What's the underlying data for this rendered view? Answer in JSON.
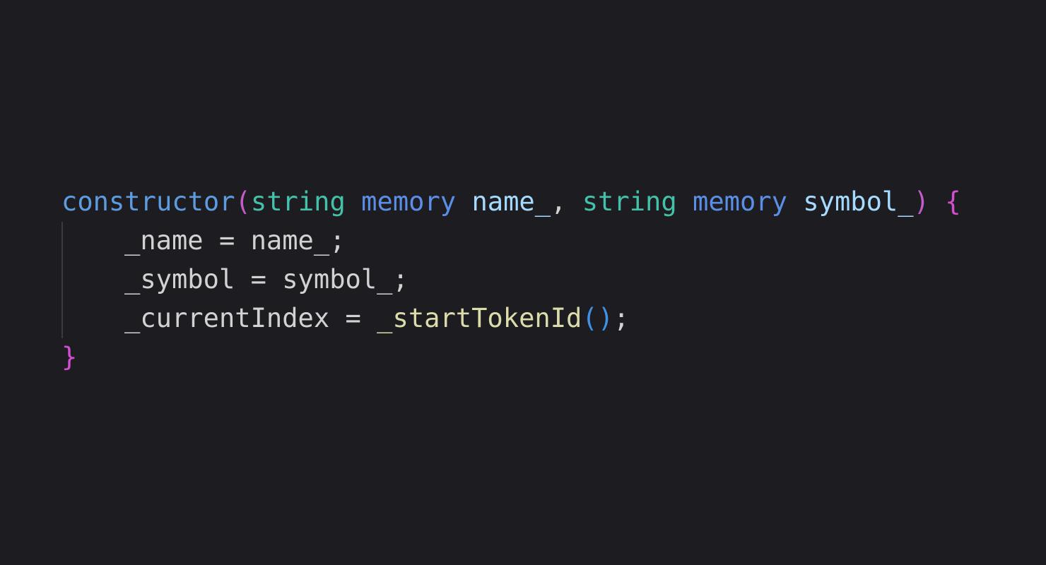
{
  "editor": {
    "background": "#1d1d21",
    "language": "Solidity",
    "colors": {
      "function_name": "#5d9ce0",
      "type": "#44c2a9",
      "keyword": "#5b8ee6",
      "parameter": "#a6dbff",
      "identifier": "#d2d2d2",
      "call": "#dcdcaa",
      "bracket_level1": "#c45bc8",
      "bracket_level2": "#3f93e6",
      "brace": "#d34ed0"
    },
    "lines": [
      {
        "tokens": [
          {
            "text": "constructor",
            "kind": "function_name"
          },
          {
            "text": "(",
            "kind": "bracket_level1"
          },
          {
            "text": "string",
            "kind": "type"
          },
          {
            "text": " ",
            "kind": "space"
          },
          {
            "text": "memory",
            "kind": "keyword"
          },
          {
            "text": " ",
            "kind": "space"
          },
          {
            "text": "name_",
            "kind": "parameter"
          },
          {
            "text": ", ",
            "kind": "identifier"
          },
          {
            "text": "string",
            "kind": "type"
          },
          {
            "text": " ",
            "kind": "space"
          },
          {
            "text": "memory",
            "kind": "keyword"
          },
          {
            "text": " ",
            "kind": "space"
          },
          {
            "text": "symbol_",
            "kind": "parameter"
          },
          {
            "text": ")",
            "kind": "bracket_level1"
          },
          {
            "text": " ",
            "kind": "space"
          },
          {
            "text": "{",
            "kind": "brace"
          }
        ]
      },
      {
        "tokens": [
          {
            "text": "_name = name_;",
            "kind": "identifier"
          }
        ]
      },
      {
        "tokens": [
          {
            "text": "_symbol = symbol_;",
            "kind": "identifier"
          }
        ]
      },
      {
        "tokens": [
          {
            "text": "_currentIndex = ",
            "kind": "identifier"
          },
          {
            "text": "_startTokenId",
            "kind": "call"
          },
          {
            "text": "()",
            "kind": "bracket_level2"
          },
          {
            "text": ";",
            "kind": "identifier"
          }
        ]
      },
      {
        "tokens": [
          {
            "text": "}",
            "kind": "brace"
          }
        ]
      }
    ]
  }
}
